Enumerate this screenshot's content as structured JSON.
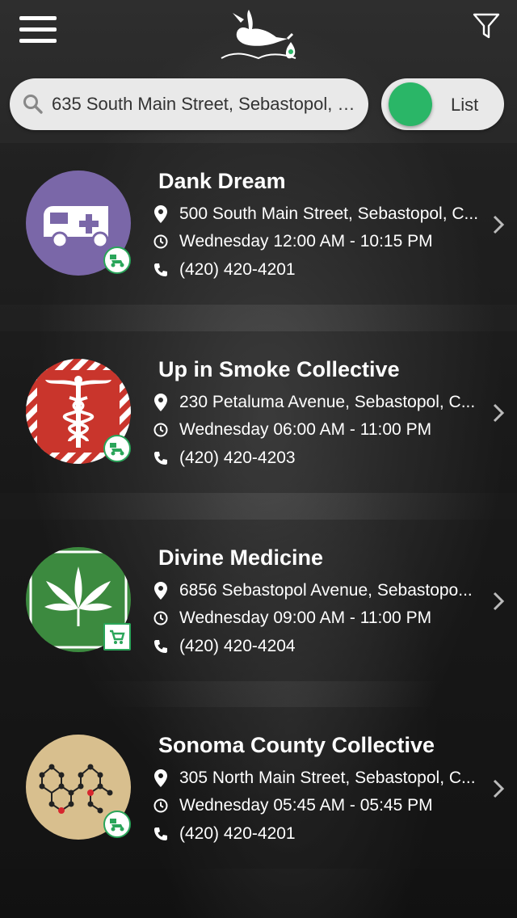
{
  "header": {
    "menu_icon": "hamburger-menu-icon",
    "logo_icon": "stork-logo-icon",
    "filter_icon": "filter-funnel-icon"
  },
  "search": {
    "value": "635 South Main Street, Sebastopol, CA...",
    "icon": "search-icon"
  },
  "view_toggle": {
    "label": "List",
    "color": "#2ab667"
  },
  "dispensaries": [
    {
      "name": "Dank Dream",
      "address": "500 South Main Street, Sebastopol, C...",
      "hours": "Wednesday 12:00 AM - 10:15 PM",
      "phone": "(420) 420-4201",
      "logo": "ambulance-logo",
      "badge": "delivery-scooter-icon"
    },
    {
      "name": "Up in Smoke Collective",
      "address": "230 Petaluma Avenue, Sebastopol, C...",
      "hours": "Wednesday 06:00 AM - 11:00 PM",
      "phone": "(420) 420-4203",
      "logo": "caduceus-logo",
      "badge": "delivery-scooter-icon"
    },
    {
      "name": "Divine Medicine",
      "address": "6856 Sebastopol Avenue, Sebastopo...",
      "hours": "Wednesday 09:00 AM - 11:00 PM",
      "phone": "(420) 420-4204",
      "logo": "cannabis-leaf-logo",
      "badge": "storefront-cart-icon"
    },
    {
      "name": "Sonoma County Collective",
      "address": "305 North Main Street, Sebastopol, C...",
      "hours": "Wednesday 05:45 AM - 05:45 PM",
      "phone": "(420) 420-4201",
      "logo": "molecule-logo",
      "badge": "delivery-scooter-icon"
    }
  ]
}
